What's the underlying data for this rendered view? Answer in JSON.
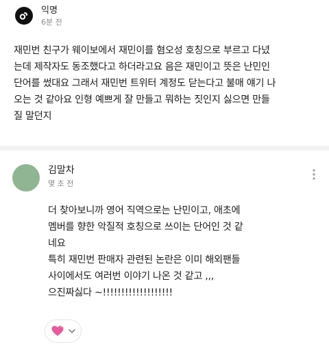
{
  "post": {
    "author": "익명",
    "time": "6분 전",
    "body_lines": [
      "재민번 친구가 웨이보에서 재민이를 혐오성 호칭으로 부르고 다녔",
      "는데 제작자도 동조했다고 하더라고요 음은 재민이고 뜻은 난민인",
      "단어를 썼대요 그래서 재민번 트위터 계정도 닫는다고 불매 얘기 나",
      "오는 것 같아요 인형 예쁘게 잘 만들고 뭐하는 짓인지 싫으면 만들",
      "질 말던지"
    ]
  },
  "comment": {
    "author": "김말차",
    "time": "몇 초 전",
    "avatar_color": "#8fb592",
    "body_lines": [
      "더 찾아보니까 영어 직역으로는 난민이고, 애초에",
      "멤버를 향한 악질적 호칭으로 쓰이는 단어인 것 같",
      "네요",
      "특히 재민번 판매자 관련된 논란은 이미 해외팬들",
      "사이에서도 여러번 이야기 나온 것 같고 ,,,",
      "으진짜싫다 ~!!!!!!!!!!!!!!!!!!!"
    ]
  },
  "icons": {
    "post_avatar": "anonymous-logo-icon",
    "more": "more-vertical-icon",
    "reaction": "sparkling-heart-icon",
    "dropdown": "chevron-down-icon"
  },
  "colors": {
    "accent_heart": "#e85aa0",
    "divider": "#f2f2f2",
    "muted_text": "#8a8a8a"
  }
}
